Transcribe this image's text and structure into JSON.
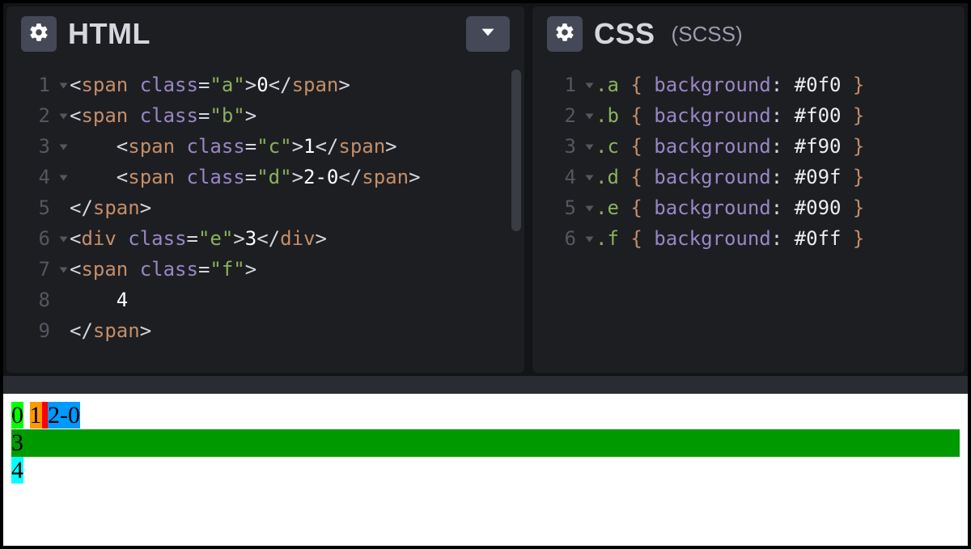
{
  "panels": {
    "html": {
      "title": "HTML",
      "subtitle": ""
    },
    "css": {
      "title": "CSS",
      "subtitle": "(SCSS)"
    }
  },
  "html_editor": {
    "line_numbers": [
      "1",
      "2",
      "3",
      "4",
      "5",
      "6",
      "7",
      "8",
      "9"
    ],
    "fold_lines": [
      1,
      2,
      3,
      4,
      6,
      7
    ],
    "lines": [
      [
        {
          "t": "punct",
          "v": "<"
        },
        {
          "t": "tag",
          "v": "span"
        },
        {
          "t": "punct",
          "v": " "
        },
        {
          "t": "attr",
          "v": "class"
        },
        {
          "t": "punct",
          "v": "="
        },
        {
          "t": "str",
          "v": "\"a\""
        },
        {
          "t": "punct",
          "v": ">"
        },
        {
          "t": "text",
          "v": "0"
        },
        {
          "t": "punct",
          "v": "</"
        },
        {
          "t": "tag",
          "v": "span"
        },
        {
          "t": "punct",
          "v": ">"
        }
      ],
      [
        {
          "t": "punct",
          "v": "<"
        },
        {
          "t": "tag",
          "v": "span"
        },
        {
          "t": "punct",
          "v": " "
        },
        {
          "t": "attr",
          "v": "class"
        },
        {
          "t": "punct",
          "v": "="
        },
        {
          "t": "str",
          "v": "\"b\""
        },
        {
          "t": "punct",
          "v": ">"
        }
      ],
      [
        {
          "t": "punct",
          "v": "    <"
        },
        {
          "t": "tag",
          "v": "span"
        },
        {
          "t": "punct",
          "v": " "
        },
        {
          "t": "attr",
          "v": "class"
        },
        {
          "t": "punct",
          "v": "="
        },
        {
          "t": "str",
          "v": "\"c\""
        },
        {
          "t": "punct",
          "v": ">"
        },
        {
          "t": "text",
          "v": "1"
        },
        {
          "t": "punct",
          "v": "</"
        },
        {
          "t": "tag",
          "v": "span"
        },
        {
          "t": "punct",
          "v": ">"
        }
      ],
      [
        {
          "t": "punct",
          "v": "    <"
        },
        {
          "t": "tag",
          "v": "span"
        },
        {
          "t": "punct",
          "v": " "
        },
        {
          "t": "attr",
          "v": "class"
        },
        {
          "t": "punct",
          "v": "="
        },
        {
          "t": "str",
          "v": "\"d\""
        },
        {
          "t": "punct",
          "v": ">"
        },
        {
          "t": "text",
          "v": "2-0"
        },
        {
          "t": "punct",
          "v": "</"
        },
        {
          "t": "tag",
          "v": "span"
        },
        {
          "t": "punct",
          "v": ">"
        }
      ],
      [
        {
          "t": "punct",
          "v": "</"
        },
        {
          "t": "tag",
          "v": "span"
        },
        {
          "t": "punct",
          "v": ">"
        }
      ],
      [
        {
          "t": "punct",
          "v": "<"
        },
        {
          "t": "tag",
          "v": "div"
        },
        {
          "t": "punct",
          "v": " "
        },
        {
          "t": "attr",
          "v": "class"
        },
        {
          "t": "punct",
          "v": "="
        },
        {
          "t": "str",
          "v": "\"e\""
        },
        {
          "t": "punct",
          "v": ">"
        },
        {
          "t": "text",
          "v": "3"
        },
        {
          "t": "punct",
          "v": "</"
        },
        {
          "t": "tag",
          "v": "div"
        },
        {
          "t": "punct",
          "v": ">"
        }
      ],
      [
        {
          "t": "punct",
          "v": "<"
        },
        {
          "t": "tag",
          "v": "span"
        },
        {
          "t": "punct",
          "v": " "
        },
        {
          "t": "attr",
          "v": "class"
        },
        {
          "t": "punct",
          "v": "="
        },
        {
          "t": "str",
          "v": "\"f\""
        },
        {
          "t": "punct",
          "v": ">"
        }
      ],
      [
        {
          "t": "text",
          "v": "    4"
        }
      ],
      [
        {
          "t": "punct",
          "v": "</"
        },
        {
          "t": "tag",
          "v": "span"
        },
        {
          "t": "punct",
          "v": ">"
        }
      ]
    ]
  },
  "css_editor": {
    "line_numbers": [
      "1",
      "2",
      "3",
      "4",
      "5",
      "6"
    ],
    "fold_lines": [
      1,
      2,
      3,
      4,
      5,
      6
    ],
    "lines": [
      [
        {
          "t": "str",
          "v": ".a"
        },
        {
          "t": "punct",
          "v": " "
        },
        {
          "t": "tag",
          "v": "{"
        },
        {
          "t": "punct",
          "v": " "
        },
        {
          "t": "attr",
          "v": "background"
        },
        {
          "t": "punct",
          "v": ": "
        },
        {
          "t": "hex",
          "v": "#0f0"
        },
        {
          "t": "punct",
          "v": " "
        },
        {
          "t": "tag",
          "v": "}"
        }
      ],
      [
        {
          "t": "str",
          "v": ".b"
        },
        {
          "t": "punct",
          "v": " "
        },
        {
          "t": "tag",
          "v": "{"
        },
        {
          "t": "punct",
          "v": " "
        },
        {
          "t": "attr",
          "v": "background"
        },
        {
          "t": "punct",
          "v": ": "
        },
        {
          "t": "hex",
          "v": "#f00"
        },
        {
          "t": "punct",
          "v": " "
        },
        {
          "t": "tag",
          "v": "}"
        }
      ],
      [
        {
          "t": "str",
          "v": ".c"
        },
        {
          "t": "punct",
          "v": " "
        },
        {
          "t": "tag",
          "v": "{"
        },
        {
          "t": "punct",
          "v": " "
        },
        {
          "t": "attr",
          "v": "background"
        },
        {
          "t": "punct",
          "v": ": "
        },
        {
          "t": "hex",
          "v": "#f90"
        },
        {
          "t": "punct",
          "v": " "
        },
        {
          "t": "tag",
          "v": "}"
        }
      ],
      [
        {
          "t": "str",
          "v": ".d"
        },
        {
          "t": "punct",
          "v": " "
        },
        {
          "t": "tag",
          "v": "{"
        },
        {
          "t": "punct",
          "v": " "
        },
        {
          "t": "attr",
          "v": "background"
        },
        {
          "t": "punct",
          "v": ": "
        },
        {
          "t": "hex",
          "v": "#09f"
        },
        {
          "t": "punct",
          "v": " "
        },
        {
          "t": "tag",
          "v": "}"
        }
      ],
      [
        {
          "t": "str",
          "v": ".e"
        },
        {
          "t": "punct",
          "v": " "
        },
        {
          "t": "tag",
          "v": "{"
        },
        {
          "t": "punct",
          "v": " "
        },
        {
          "t": "attr",
          "v": "background"
        },
        {
          "t": "punct",
          "v": ": "
        },
        {
          "t": "hex",
          "v": "#090"
        },
        {
          "t": "punct",
          "v": " "
        },
        {
          "t": "tag",
          "v": "}"
        }
      ],
      [
        {
          "t": "str",
          "v": ".f"
        },
        {
          "t": "punct",
          "v": " "
        },
        {
          "t": "tag",
          "v": "{"
        },
        {
          "t": "punct",
          "v": " "
        },
        {
          "t": "attr",
          "v": "background"
        },
        {
          "t": "punct",
          "v": ": "
        },
        {
          "t": "hex",
          "v": "#0ff"
        },
        {
          "t": "punct",
          "v": " "
        },
        {
          "t": "tag",
          "v": "}"
        }
      ]
    ]
  },
  "preview": {
    "a": "0",
    "c": "1",
    "d": "2-0",
    "e": "3",
    "f": "4"
  }
}
